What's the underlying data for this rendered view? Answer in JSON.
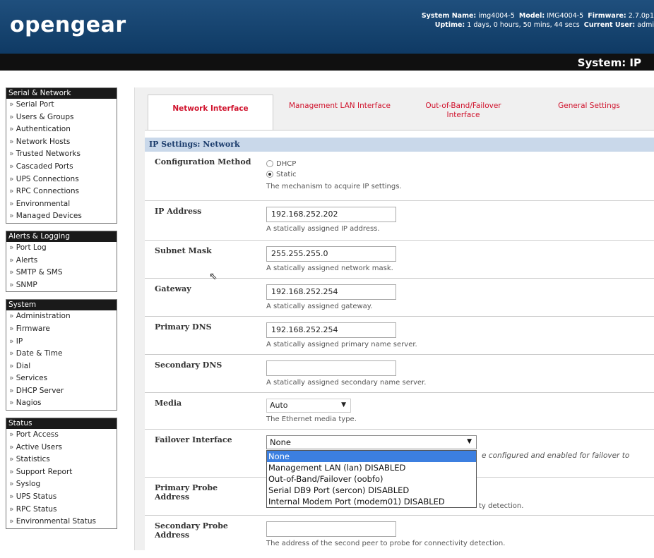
{
  "header": {
    "logo": "opengear",
    "system_name_label": "System Name:",
    "system_name": "img4004-5",
    "model_label": "Model:",
    "model": "IMG4004-5",
    "firmware_label": "Firmware:",
    "firmware": "2.7.0p1",
    "uptime_label": "Uptime:",
    "uptime": "1 days, 0 hours, 50 mins, 44 secs",
    "user_label": "Current User:",
    "user": "admi",
    "page_title": "System: IP"
  },
  "sidebar": {
    "sections": [
      {
        "title": "Serial & Network",
        "items": [
          "Serial Port",
          "Users & Groups",
          "Authentication",
          "Network Hosts",
          "Trusted Networks",
          "Cascaded Ports",
          "UPS Connections",
          "RPC Connections",
          "Environmental",
          "Managed Devices"
        ]
      },
      {
        "title": "Alerts & Logging",
        "items": [
          "Port Log",
          "Alerts",
          "SMTP & SMS",
          "SNMP"
        ]
      },
      {
        "title": "System",
        "items": [
          "Administration",
          "Firmware",
          "IP",
          "Date & Time",
          "Dial",
          "Services",
          "DHCP Server",
          "Nagios"
        ]
      },
      {
        "title": "Status",
        "items": [
          "Port Access",
          "Active Users",
          "Statistics",
          "Support Report",
          "Syslog",
          "UPS Status",
          "RPC Status",
          "Environmental Status"
        ]
      }
    ]
  },
  "tabs": [
    {
      "label": "Network Interface",
      "active": true
    },
    {
      "label": "Management LAN Interface",
      "active": false
    },
    {
      "label": "Out-of-Band/Failover Interface",
      "active": false
    },
    {
      "label": "General Settings",
      "active": false
    }
  ],
  "form": {
    "section_title": "IP Settings: Network",
    "config_method": {
      "label": "Configuration Method",
      "options": [
        "DHCP",
        "Static"
      ],
      "selected": "Static",
      "help": "The mechanism to acquire IP settings."
    },
    "ip_address": {
      "label": "IP Address",
      "value": "192.168.252.202",
      "help": "A statically assigned IP address."
    },
    "subnet_mask": {
      "label": "Subnet Mask",
      "value": "255.255.255.0",
      "help": "A statically assigned network mask."
    },
    "gateway": {
      "label": "Gateway",
      "value": "192.168.252.254",
      "help": "A statically assigned gateway."
    },
    "primary_dns": {
      "label": "Primary DNS",
      "value": "192.168.252.254",
      "help": "A statically assigned primary name server."
    },
    "secondary_dns": {
      "label": "Secondary DNS",
      "value": "",
      "help": "A statically assigned secondary name server."
    },
    "media": {
      "label": "Media",
      "value": "Auto",
      "help": "The Ethernet media type."
    },
    "failover": {
      "label": "Failover Interface",
      "value": "None",
      "options": [
        "None",
        "Management LAN (lan) DISABLED",
        "Out-of-Band/Failover (oobfo)",
        "Serial DB9 Port (sercon) DISABLED",
        "Internal Modem Port (modem01) DISABLED"
      ],
      "help_partial": "e configured and enabled for failover to"
    },
    "primary_probe": {
      "label": "Primary Probe Address",
      "value": "",
      "help_partial": "ty detection."
    },
    "secondary_probe": {
      "label": "Secondary Probe Address",
      "value": "",
      "help": "The address of the second peer to probe for connectivity detection."
    }
  }
}
